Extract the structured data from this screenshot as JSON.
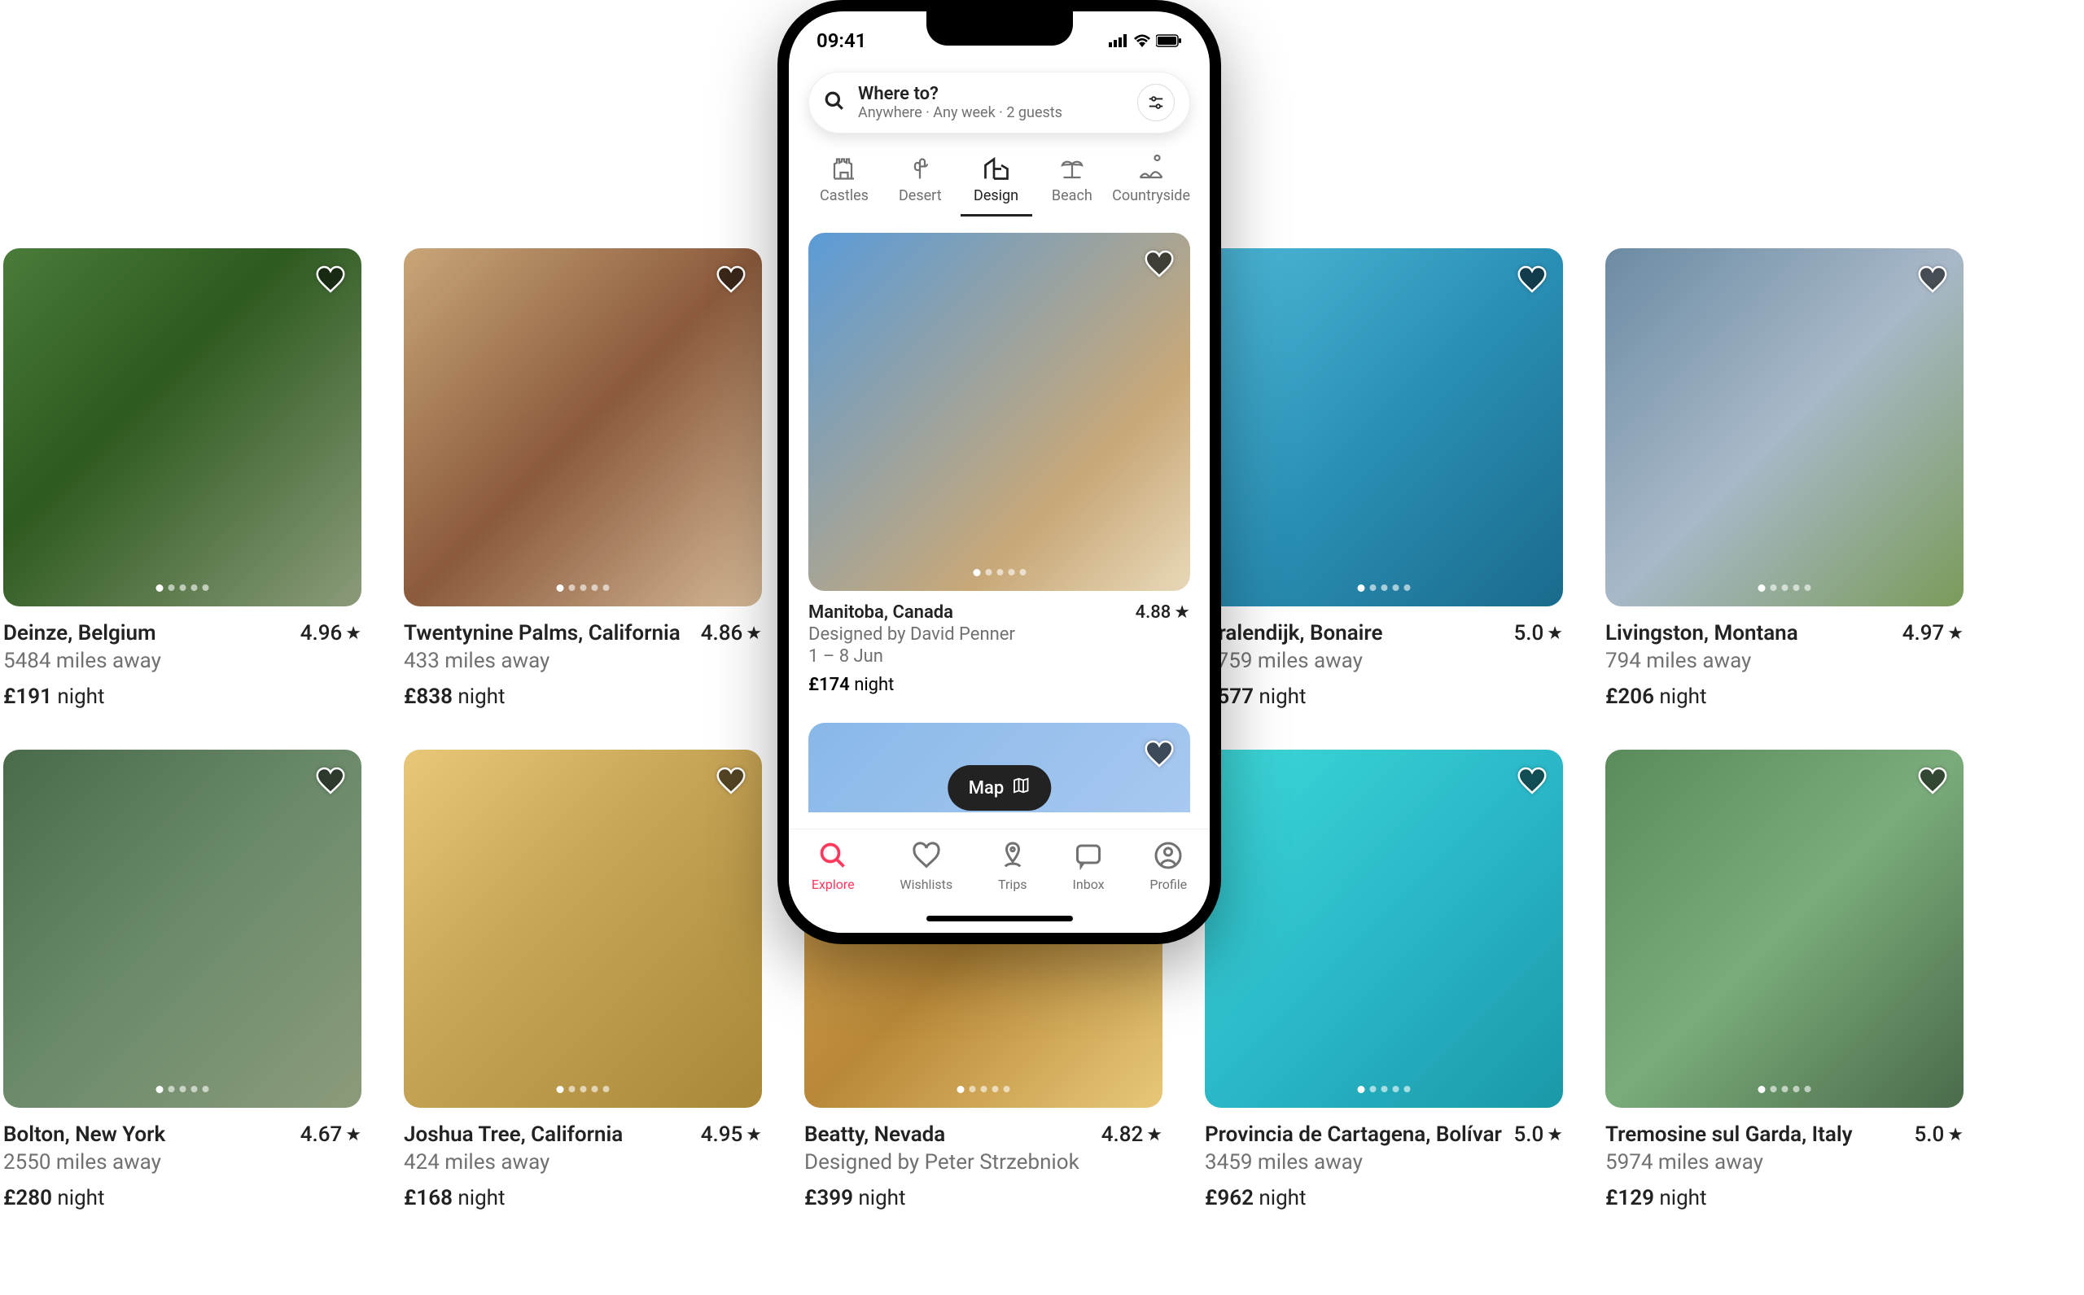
{
  "phone": {
    "time": "09:41",
    "search": {
      "title": "Where to?",
      "subtitle": "Anywhere · Any week · 2 guests"
    },
    "categories": [
      {
        "label": "Castles"
      },
      {
        "label": "Desert"
      },
      {
        "label": "Design",
        "active": true
      },
      {
        "label": "Beach"
      },
      {
        "label": "Countryside"
      }
    ],
    "featured": {
      "location": "Manitoba, Canada",
      "rating": "4.88",
      "designer": "Designed by David Penner",
      "dates": "1 – 8 Jun",
      "price": "£174",
      "price_unit": "night"
    },
    "map_label": "Map",
    "tabs": [
      {
        "label": "Explore",
        "active": true
      },
      {
        "label": "Wishlists"
      },
      {
        "label": "Trips"
      },
      {
        "label": "Inbox"
      },
      {
        "label": "Profile"
      }
    ]
  },
  "listings": [
    {
      "location": "Deinze, Belgium",
      "distance": "5484 miles away",
      "rating": "4.96",
      "price": "£191",
      "unit": "night",
      "g": "g1"
    },
    {
      "location": "Twentynine Palms, California",
      "distance": "433 miles away",
      "rating": "4.86",
      "price": "£838",
      "unit": "night",
      "g": "g2"
    },
    {
      "location": "",
      "distance": "",
      "rating": "",
      "price": "",
      "unit": "",
      "g": "g10",
      "hidden": true
    },
    {
      "location": "Kralendijk, Bonaire",
      "distance": "3759 miles away",
      "rating": "5.0",
      "price": "£577",
      "unit": "night",
      "g": "g3"
    },
    {
      "location": "Livingston, Montana",
      "distance": "794 miles away",
      "rating": "4.97",
      "price": "£206",
      "unit": "night",
      "g": "g4"
    },
    {
      "location": "Bolton, New York",
      "distance": "2550 miles away",
      "rating": "4.67",
      "price": "£280",
      "unit": "night",
      "g": "g5"
    },
    {
      "location": "Joshua Tree, California",
      "distance": "424 miles away",
      "rating": "4.95",
      "price": "£168",
      "unit": "night",
      "g": "g6"
    },
    {
      "location": "Beatty, Nevada",
      "distance": "Designed by Peter Strzebniok",
      "rating": "4.82",
      "price": "£399",
      "unit": "night",
      "g": "g7"
    },
    {
      "location": "Provincia de Cartagena, Bolívar",
      "distance": "3459 miles away",
      "rating": "5.0",
      "price": "£962",
      "unit": "night",
      "g": "g8"
    },
    {
      "location": "Tremosine sul Garda, Italy",
      "distance": "5974 miles away",
      "rating": "5.0",
      "price": "£129",
      "unit": "night",
      "g": "g9"
    }
  ]
}
